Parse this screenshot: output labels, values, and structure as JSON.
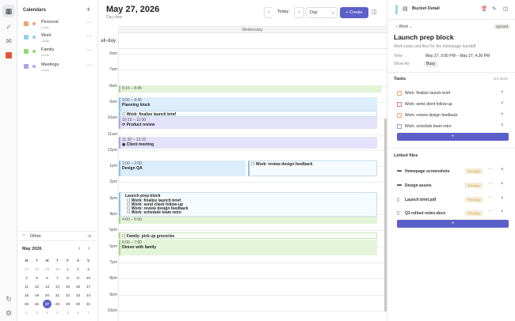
{
  "sidebar": {
    "title": "Calendars",
    "calendars": [
      {
        "name": "Personal",
        "sub": "Local",
        "color": "#f0a46b",
        "check": "#f0a46b"
      },
      {
        "name": "Work",
        "sub": "Local",
        "color": "#8fd0ec",
        "check": "#8fd0ec"
      },
      {
        "name": "Family",
        "sub": "Local",
        "color": "#8fd96f",
        "check": "#8fd96f"
      },
      {
        "name": "Meetings",
        "sub": "Local",
        "color": "#a9a5ea",
        "check": "#a9a5ea"
      }
    ],
    "other_label": "Other",
    "other_count": "0",
    "mini_title": "May 2026",
    "weekdays": [
      "M",
      "T",
      "W",
      "T",
      "F",
      "S",
      "S"
    ],
    "weeks": [
      [
        "27",
        "28",
        "29",
        "30",
        "1",
        "2",
        "3"
      ],
      [
        "4",
        "5",
        "6",
        "7",
        "8",
        "9",
        "10"
      ],
      [
        "11",
        "12",
        "13",
        "14",
        "15",
        "16",
        "17"
      ],
      [
        "18",
        "19",
        "20",
        "21",
        "22",
        "23",
        "24"
      ],
      [
        "25",
        "26",
        "27",
        "28",
        "29",
        "30",
        "31"
      ],
      [
        "1",
        "2",
        "3",
        "4",
        "5",
        "6",
        "7"
      ]
    ],
    "today": "27"
  },
  "toolbar": {
    "date_title": "May 27, 2026",
    "view_sub": "Day view",
    "prev": "‹",
    "today": "Today",
    "next": "›",
    "view_select": "Day",
    "create": "+ Create"
  },
  "day": {
    "weekday": "Wednesday",
    "allday_label": "all-day",
    "hours": [
      "6am",
      "7am",
      "8am",
      "9am",
      "10am",
      "11am",
      "12pm",
      "1pm",
      "2pm",
      "3pm",
      "4pm",
      "5pm",
      "6pm",
      "7pm",
      "8pm",
      "9pm",
      "10pm"
    ]
  },
  "events": {
    "e1": {
      "time": "8:15 – 8:45",
      "title": ""
    },
    "e2": {
      "time": "9:00 – 9:45",
      "title": "Planning block"
    },
    "e3": {
      "title": "Work: finalize launch brief"
    },
    "e4": {
      "time": "10:15 – 11:00",
      "title": "Product review"
    },
    "e5": {
      "time": "11:30 – 12:15",
      "title": "Client meeting"
    },
    "e6": {
      "time": "1:00 – 2:00",
      "title": "Design QA"
    },
    "e7": {
      "title": "Work: review design feedback"
    },
    "e8": {
      "title": "Launch prep block",
      "lines": [
        "Work: finalize launch brief",
        "Work: send client follow-up",
        "Work: review design feedback",
        "Work: schedule team retro"
      ]
    },
    "e9": {
      "time": "4:00 – 5:00",
      "title": ""
    },
    "e10": {
      "title": "Family: pick up groceries"
    },
    "e11": {
      "time": "6:00 – 7:00",
      "title": "Dinner with family"
    }
  },
  "detail": {
    "header_title": "Bucket Detail",
    "tag": "Work",
    "synced": "Synced",
    "title": "Launch prep block",
    "desc": "Work tasks and files for the homepage handoff.",
    "time_label": "Time",
    "time_value": "May 27, 3:00 PM – May 27, 4:30 PM",
    "show_label": "Show As",
    "show_value": "Busy",
    "tasks_title": "Tasks",
    "tasks_meta": "0/4 tasks",
    "tasks": [
      {
        "label": "Work: finalize launch brief",
        "color": "#f0a46b"
      },
      {
        "label": "Work: send client follow-up",
        "color": "#e27272"
      },
      {
        "label": "Work: review design feedback",
        "color": "#f0a46b"
      },
      {
        "label": "Work: schedule team retro",
        "color": "#7fa6d9"
      }
    ],
    "add": "+",
    "files_title": "Linked files",
    "files": [
      {
        "name": "Homepage screenshots",
        "icon": "folder"
      },
      {
        "name": "Design assets",
        "icon": "folder"
      },
      {
        "name": "Launch brief.pdf",
        "icon": "file"
      },
      {
        "name": "Q3 rollout notes.docx",
        "icon": "file"
      }
    ],
    "file_badge": "Pending"
  },
  "colors": {
    "accent": "#5b5fc7",
    "blue_event": "#dcedfb",
    "green_event": "#e4f4d8",
    "purple_event": "#e4e2fb"
  }
}
